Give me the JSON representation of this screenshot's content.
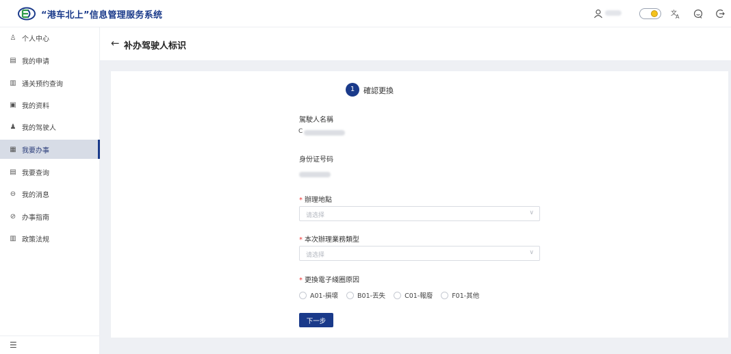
{
  "header": {
    "app_title": "“港车北上”信息管理服务系统",
    "icons": [
      "logo-icon",
      "user-icon",
      "theme-toggle",
      "translate-icon",
      "chat-icon",
      "logout-icon"
    ],
    "brand_color": "#1a3a8a"
  },
  "sidebar": {
    "items": [
      {
        "label": "个人中心",
        "icon": "user-icon"
      },
      {
        "label": "我的申请",
        "icon": "form-icon"
      },
      {
        "label": "通关预约查询",
        "icon": "booking-icon"
      },
      {
        "label": "我的资料",
        "icon": "id-card-icon"
      },
      {
        "label": "我的驾驶人",
        "icon": "drivers-icon"
      },
      {
        "label": "我要办事",
        "icon": "task-icon",
        "active": true
      },
      {
        "label": "我要查询",
        "icon": "query-icon"
      },
      {
        "label": "我的消息",
        "icon": "message-icon"
      },
      {
        "label": "办事指南",
        "icon": "compass-icon"
      },
      {
        "label": "政策法规",
        "icon": "book-icon"
      }
    ]
  },
  "page": {
    "title": "补办驾驶人标识"
  },
  "steps": [
    {
      "number": "1",
      "label": "確認更換"
    }
  ],
  "form": {
    "driver_name_label": "駕駛人名稱",
    "driver_name_prefix": "C",
    "id_number_label": "身份证号码",
    "location_label": "辦理地點",
    "location_placeholder": "请选择",
    "business_type_label": "本次辦理業務類型",
    "business_type_placeholder": "请选择",
    "reason_label": "更換電子綫圈原因",
    "reasons": [
      "A01-損壞",
      "B01-丟失",
      "C01-報廢",
      "F01-其他"
    ],
    "required_mark": "*",
    "next_button": "下一步"
  }
}
